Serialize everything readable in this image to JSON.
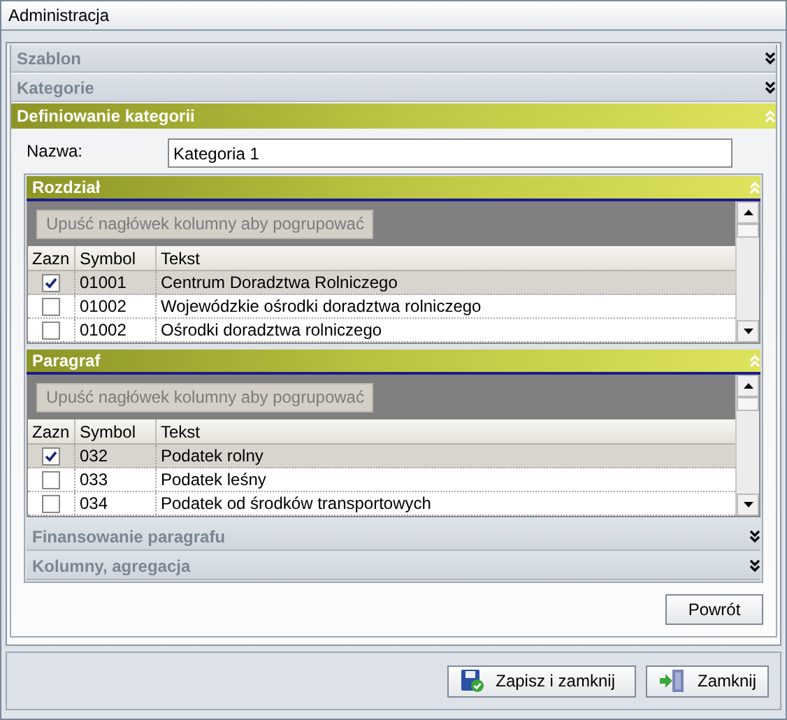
{
  "window": {
    "title": "Administracja"
  },
  "sections": [
    {
      "title": "Szablon",
      "expanded": false
    },
    {
      "title": "Kategorie",
      "expanded": false
    },
    {
      "title": "Definiowanie kategorii",
      "expanded": true,
      "name_label": "Nazwa:",
      "name_value": "Kategoria 1",
      "subsections": [
        {
          "title": "Rozdział",
          "expanded": true,
          "grid": {
            "group_hint": "Upuść nagłówek kolumny aby pogrupować",
            "columns": [
              "Zazn",
              "Symbol",
              "Tekst"
            ],
            "rows": [
              {
                "checked": true,
                "selected": true,
                "symbol": "01001",
                "text": "Centrum Doradztwa Rolniczego"
              },
              {
                "checked": false,
                "selected": false,
                "symbol": "01002",
                "text": "Wojewódzkie ośrodki doradztwa rolniczego"
              },
              {
                "checked": false,
                "selected": false,
                "symbol": "01002",
                "text": "Ośrodki doradztwa rolniczego"
              }
            ]
          }
        },
        {
          "title": "Paragraf",
          "expanded": true,
          "grid": {
            "group_hint": "Upuść nagłówek kolumny aby pogrupować",
            "columns": [
              "Zazn",
              "Symbol",
              "Tekst"
            ],
            "rows": [
              {
                "checked": true,
                "selected": true,
                "symbol": "032",
                "text": "Podatek rolny"
              },
              {
                "checked": false,
                "selected": false,
                "symbol": "033",
                "text": "Podatek leśny"
              },
              {
                "checked": false,
                "selected": false,
                "symbol": "034",
                "text": "Podatek od środków transportowych"
              }
            ]
          }
        },
        {
          "title": "Finansowanie paragrafu",
          "expanded": false
        },
        {
          "title": "Kolumny, agregacja",
          "expanded": false
        }
      ],
      "back_button": "Powrót"
    }
  ],
  "buttons": [
    {
      "label": "Zapisz i zamknij",
      "kind": "save"
    },
    {
      "label": "Zamknij",
      "kind": "close"
    }
  ]
}
